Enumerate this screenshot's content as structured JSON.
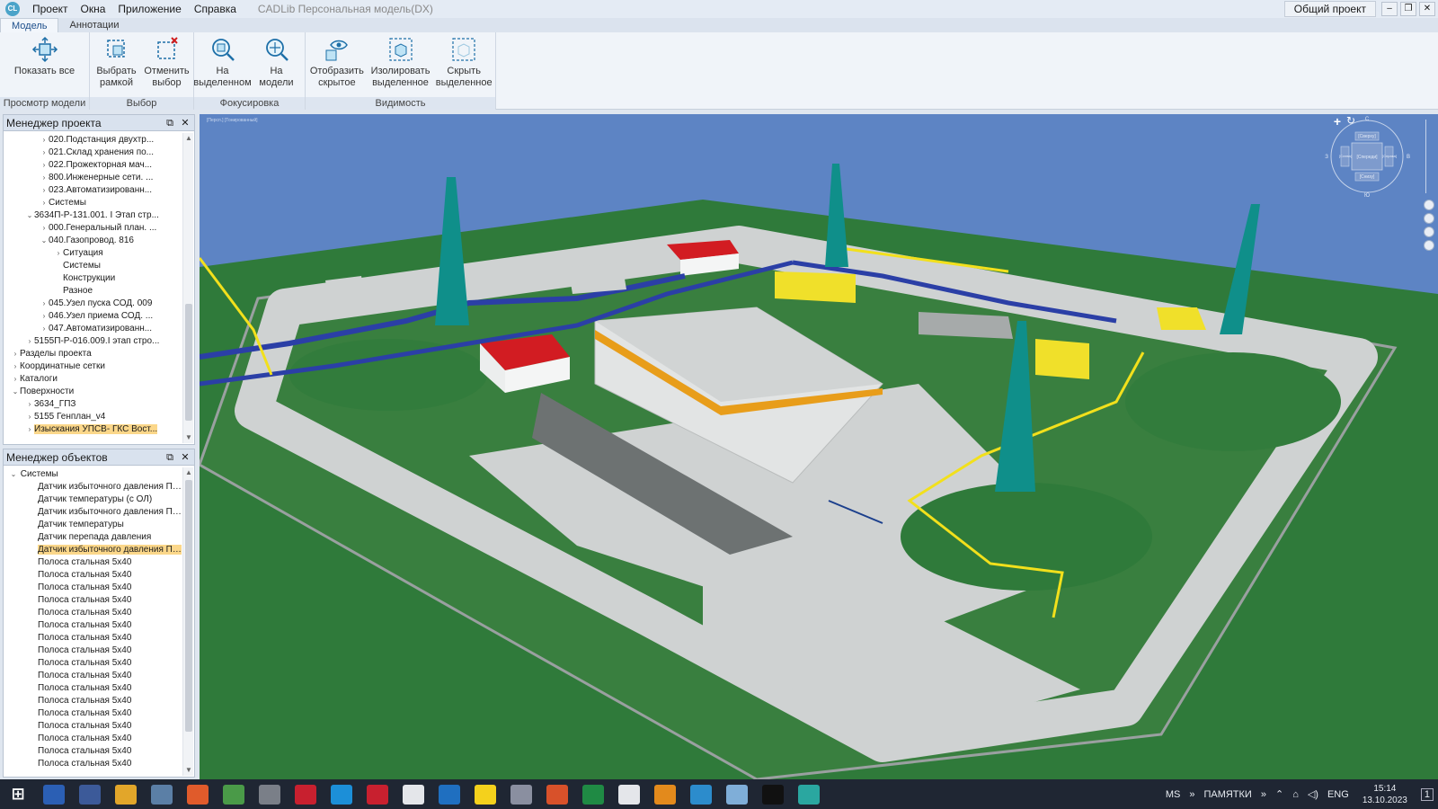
{
  "app": {
    "title": "CADLib Персональная модель(DX)",
    "logo": "CL",
    "shared_project": "Общий проект",
    "menu": [
      "Проект",
      "Окна",
      "Приложение",
      "Справка"
    ],
    "window_buttons": [
      "–",
      "❐",
      "✕"
    ]
  },
  "ribbon": {
    "tabs": [
      "Модель",
      "Аннотации"
    ],
    "groups": [
      {
        "title": "Просмотр модели",
        "buttons": [
          {
            "label": "Показать все",
            "icon": "show-all-icon"
          }
        ]
      },
      {
        "title": "Выбор",
        "buttons": [
          {
            "label": "Выбрать\nрамкой",
            "icon": "select-frame-icon"
          },
          {
            "label": "Отменить\nвыбор",
            "icon": "cancel-selection-icon"
          }
        ]
      },
      {
        "title": "Фокусировка",
        "buttons": [
          {
            "label": "На\nвыделенном",
            "icon": "zoom-selected-icon"
          },
          {
            "label": "На\nмодели",
            "icon": "zoom-model-icon"
          }
        ]
      },
      {
        "title": "Видимость",
        "buttons": [
          {
            "label": "Отобразить\nскрытое",
            "icon": "show-hidden-icon"
          },
          {
            "label": "Изолировать\nвыделенное",
            "icon": "isolate-icon"
          },
          {
            "label": "Скрыть\nвыделенное",
            "icon": "hide-icon"
          }
        ]
      }
    ]
  },
  "project_manager": {
    "title": "Менеджер проекта",
    "items": [
      {
        "label": "020.Подстанция двухтр...",
        "level": 4,
        "arrow": "›"
      },
      {
        "label": "021.Склад хранения по...",
        "level": 4,
        "arrow": "›"
      },
      {
        "label": "022.Прожекторная мач...",
        "level": 4,
        "arrow": "›"
      },
      {
        "label": "800.Инженерные сети. ...",
        "level": 4,
        "arrow": "›"
      },
      {
        "label": "023.Автоматизированн...",
        "level": 4,
        "arrow": "›"
      },
      {
        "label": "Системы",
        "level": 4,
        "arrow": "›"
      },
      {
        "label": "3634П-Р-131.001. I Этап стр...",
        "level": 3,
        "arrow": "⌄"
      },
      {
        "label": "000.Генеральный план. ...",
        "level": 4,
        "arrow": "›"
      },
      {
        "label": "040.Газопровод. 816",
        "level": 4,
        "arrow": "⌄"
      },
      {
        "label": "Ситуация",
        "level": 5,
        "arrow": "›"
      },
      {
        "label": "Системы",
        "level": 5,
        "arrow": ""
      },
      {
        "label": "Конструкции",
        "level": 5,
        "arrow": ""
      },
      {
        "label": "Разное",
        "level": 5,
        "arrow": ""
      },
      {
        "label": "045.Узел пуска СОД. 009",
        "level": 4,
        "arrow": "›"
      },
      {
        "label": "046.Узел приема СОД. ...",
        "level": 4,
        "arrow": "›"
      },
      {
        "label": "047.Автоматизированн...",
        "level": 4,
        "arrow": "›"
      },
      {
        "label": "5155П-Р-016.009.I этап стро...",
        "level": 3,
        "arrow": "›"
      },
      {
        "label": "Разделы проекта",
        "level": 2,
        "arrow": "›"
      },
      {
        "label": "Координатные сетки",
        "level": 2,
        "arrow": "›"
      },
      {
        "label": "Каталоги",
        "level": 2,
        "arrow": "›"
      },
      {
        "label": "Поверхности",
        "level": 2,
        "arrow": "⌄"
      },
      {
        "label": "3634_ГПЗ",
        "level": 3,
        "arrow": "›"
      },
      {
        "label": "5155 Генплан_v4",
        "level": 3,
        "arrow": "›"
      },
      {
        "label": "Изыскания УПСВ- ГКС Вост...",
        "level": 3,
        "arrow": "›",
        "selected": true
      }
    ]
  },
  "object_manager": {
    "title": "Менеджер объектов",
    "root": "Системы",
    "items": [
      {
        "label": "Датчик избыточного давления ПД-..."
      },
      {
        "label": "Датчик температуры (с ОЛ)"
      },
      {
        "label": "Датчик избыточного давления ПД-..."
      },
      {
        "label": "Датчик температуры"
      },
      {
        "label": "Датчик перепада давления"
      },
      {
        "label": "Датчик избыточного давления ПД-...",
        "selected": true
      },
      {
        "label": "Полоса стальная 5х40"
      },
      {
        "label": "Полоса стальная 5х40"
      },
      {
        "label": "Полоса стальная 5х40"
      },
      {
        "label": "Полоса стальная 5х40"
      },
      {
        "label": "Полоса стальная 5х40"
      },
      {
        "label": "Полоса стальная 5х40"
      },
      {
        "label": "Полоса стальная 5х40"
      },
      {
        "label": "Полоса стальная 5х40"
      },
      {
        "label": "Полоса стальная 5х40"
      },
      {
        "label": "Полоса стальная 5х40"
      },
      {
        "label": "Полоса стальная 5х40"
      },
      {
        "label": "Полоса стальная 5х40"
      },
      {
        "label": "Полоса стальная 5х40"
      },
      {
        "label": "Полоса стальная 5х40"
      },
      {
        "label": "Полоса стальная 5х40"
      },
      {
        "label": "Полоса стальная 5х40"
      },
      {
        "label": "Полоса стальная 5х40"
      }
    ]
  },
  "viewport": {
    "label": "[Персп.] [Тонированный]",
    "navcube": {
      "top": "[Сверху]",
      "front": "[Спереди]",
      "bottom": "[Снизу]",
      "left": "[Слева]",
      "right": "[Справа]",
      "n": "С",
      "s": "Ю",
      "w": "З",
      "e": "В"
    },
    "colors": {
      "sky": "#5d84c4",
      "grass": "#2f7a3a",
      "concrete": "#cfd2d2",
      "pipe_blue": "#2b3fa6",
      "pipe_yellow": "#f2e01c",
      "mast": "#0f8f8a",
      "roof_red": "#d21c22"
    }
  },
  "taskbar": {
    "apps": [
      "windows-start-icon",
      "word-icon",
      "save-icon",
      "explorer-icon",
      "settings-icon",
      "firefox-icon",
      "notepad-icon",
      "calculator-icon",
      "acrobat-icon",
      "ie-icon",
      "a-icon",
      "doc-icon",
      "outlook-icon",
      "sticky-icon",
      "app-icon",
      "photo-icon",
      "excel-icon",
      "file-icon",
      "blender-icon",
      "chat-icon",
      "book-icon",
      "terminal-icon",
      "cl-icon"
    ],
    "tray_left": "MS",
    "tray_label": "ПАМЯТКИ",
    "lang": "ENG",
    "time": "15:14",
    "date": "13.10.2023",
    "notif": "1"
  }
}
